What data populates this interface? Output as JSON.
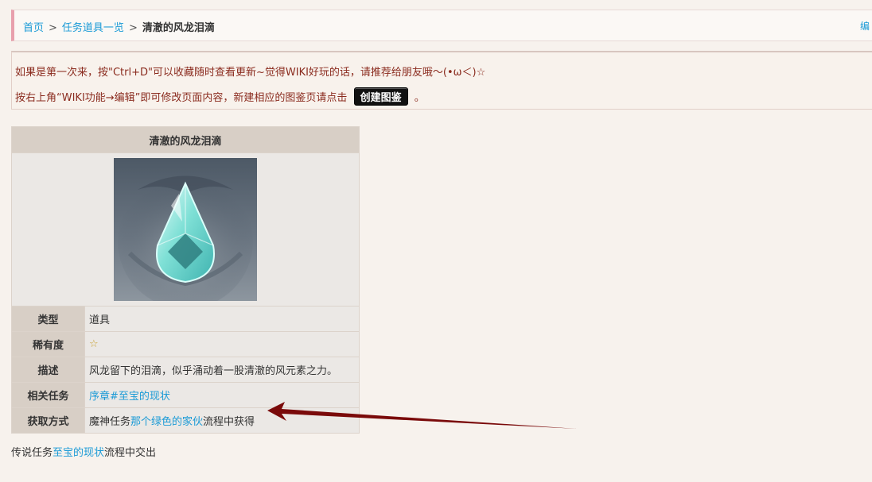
{
  "breadcrumb": {
    "home": "首页",
    "separator": ">",
    "list": "任务道具一览",
    "current": "清澈的风龙泪滴"
  },
  "edit_link": "编",
  "notice": {
    "line1": "如果是第一次来，按\"Ctrl+D\"可以收藏随时查看更新~觉得WIKI好玩的话，请推荐给朋友哦～(•ω＜)☆",
    "line2_prefix": "按右上角“WIKI功能→编辑”即可修改页面内容，新建相应的图鉴页请点击",
    "create_button": "创建图鉴",
    "line2_suffix": "。"
  },
  "infobox": {
    "title": "清澈的风龙泪滴",
    "rows": {
      "type": {
        "label": "类型",
        "value": "道具"
      },
      "rarity": {
        "label": "稀有度",
        "value": "☆"
      },
      "description": {
        "label": "描述",
        "value": "风龙留下的泪滴，似乎涌动着一股清澈的风元素之力。"
      },
      "quest": {
        "label": "相关任务",
        "link": "序章#至宝的现状"
      },
      "obtain": {
        "label": "获取方式",
        "prefix": "魔神任务",
        "link": "那个绿色的家伙",
        "suffix": "流程中获得"
      }
    }
  },
  "footer": {
    "prefix": "传说任务",
    "link": "至宝的现状",
    "suffix": "流程中交出"
  },
  "colors": {
    "link": "#1a9ad6",
    "notice_text": "#8b2c1f",
    "arrow": "#7a0a0a",
    "label_bg": "#d8cfc6"
  }
}
